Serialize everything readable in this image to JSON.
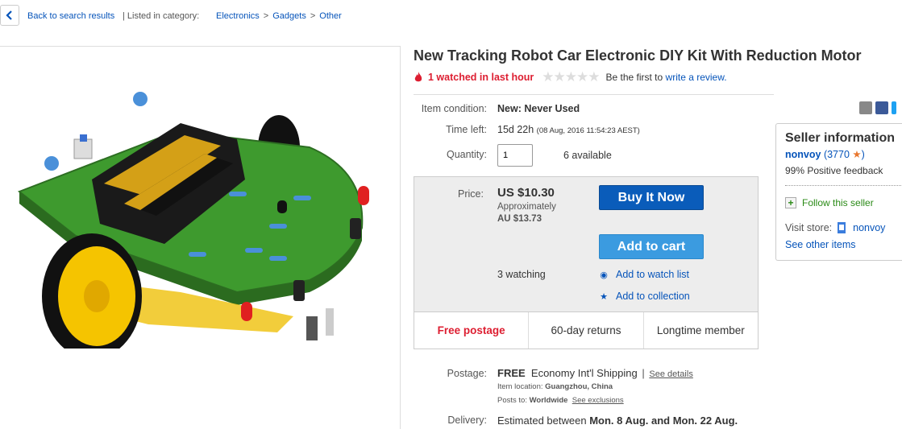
{
  "breadcrumb": {
    "back_label": "Back to search results",
    "listed_in": "| Listed in category:",
    "categories": [
      "Electronics",
      "Gadgets",
      "Other"
    ],
    "separator": ">"
  },
  "product": {
    "title": "New Tracking Robot Car Electronic DIY Kit With Reduction Motor",
    "watched": "1 watched in last hour",
    "stars": "★★★★★",
    "review_prefix": "Be the first to",
    "review_link": "write a review."
  },
  "details": {
    "condition_label": "Item condition:",
    "condition_value": "New: Never Used",
    "time_label": "Time left:",
    "time_value": "15d 22h",
    "time_detail": "(08 Aug, 2016   11:54:23 AEST)",
    "quantity_label": "Quantity:",
    "quantity_value": "1",
    "available": "6 available"
  },
  "buybox": {
    "price_label": "Price:",
    "price": "US $10.30",
    "approx": "Approximately",
    "au_price": "AU $13.73",
    "buy_now": "Buy It Now",
    "add_to_cart": "Add to cart",
    "watching": "3 watching",
    "watch_list": "Add to watch list",
    "collection": "Add to collection"
  },
  "features": [
    "Free postage",
    "60-day returns",
    "Longtime member"
  ],
  "shipping": {
    "postage_label": "Postage:",
    "free": "FREE",
    "service": "Economy Int'l Shipping",
    "sep": "|",
    "see_details": "See details",
    "location_label": "Item location:",
    "location": "Guangzhou, China",
    "posts_label": "Posts to:",
    "posts_to": "Worldwide",
    "exclusions": "See exclusions",
    "delivery_label": "Delivery:",
    "delivery_prefix": "Estimated between",
    "delivery_range": "Mon. 8 Aug. and Mon. 22 Aug."
  },
  "seller": {
    "title": "Seller information",
    "name": "nonvoy",
    "feedback_open": "(",
    "feedback": "3770",
    "feedback_close": ")",
    "positive": "99% Positive feedback",
    "follow": "Follow this seller",
    "visit_label": "Visit store:",
    "store": "nonvoy",
    "other_items": "See other items"
  },
  "colors": {
    "link": "#0654ba",
    "watched_red": "#dd1e31",
    "buy_button": "#0a5cba",
    "cart_button": "#3b9be0",
    "follow_green": "#2a8a16"
  },
  "icons": {
    "back": "chevron-left-icon",
    "watched": "flame-icon",
    "share": [
      "email-icon",
      "facebook-icon",
      "twitter-icon"
    ],
    "watch": "eye-icon",
    "collection": "star-icon",
    "follow": "plus-icon",
    "store": "store-icon"
  }
}
